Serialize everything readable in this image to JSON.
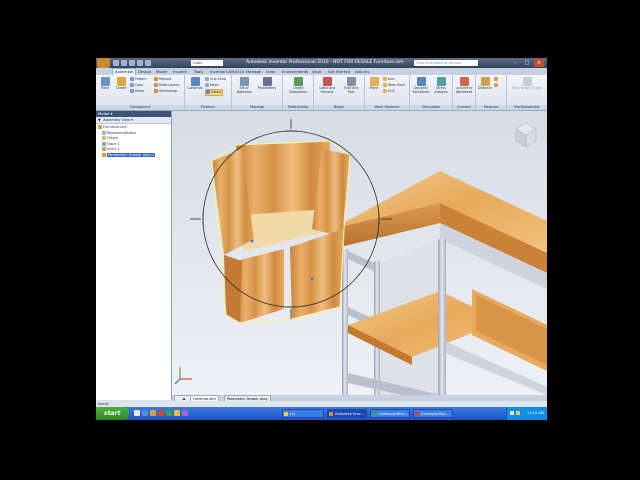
{
  "window": {
    "title": "Autodesk Inventor Professional 2010 - NOT FOR RESALE    Furniture.iam",
    "search_placeholder": "Type a keyword or phrase",
    "quick_access_value": "Color"
  },
  "tabs": [
    "Assemble",
    "Design",
    "Model",
    "Inspect",
    "Tools",
    "InventorCAM2010",
    "Manage",
    "View",
    "Environments",
    "Vault",
    "Get Started",
    "Add-Ins"
  ],
  "ribbon": {
    "groups": [
      {
        "name": "Component"
      },
      {
        "name": "Position"
      },
      {
        "name": "Manage"
      },
      {
        "name": "Productivity"
      },
      {
        "name": "Begin"
      },
      {
        "name": "Work Features"
      },
      {
        "name": "Simulation"
      },
      {
        "name": "Convert"
      },
      {
        "name": "Measure"
      },
      {
        "name": "iPartiAssembly"
      }
    ],
    "place_label": "Place",
    "create_label": "Create",
    "pattern_label": "Pattern",
    "copy_label": "Copy",
    "mirror_label": "Mirror",
    "replace_label": "Replace",
    "make_layout_label": "Make Layout",
    "shrinkwrap_label": "Shrinkwrap",
    "constrain_label": "Constrain",
    "grip_snap_label": "Grip Snap",
    "move_label": "Move",
    "rotate_label": "Rotate",
    "bom_label": "Bill of Materials",
    "parameters_label": "Parameters",
    "create_substitutes_label": "Create Substitutes",
    "cable_harness_label": "Cable and Harness",
    "tube_pipe_label": "Tube and Pipe",
    "plane_label": "Plane",
    "axis_label": "Axis",
    "work_point_label": "Work Point",
    "ucs_label": "UCS",
    "dynamic_sim_label": "Dynamic Simulation",
    "stress_label": "Stress Analysis",
    "convert_label": "Convert to Weldment",
    "distance_label": "Distance",
    "edit_factory_label": "Edit Factory Scope"
  },
  "browser": {
    "header": "Model",
    "view_label": "Assembly View",
    "items": [
      {
        "label": "Furniture.iam",
        "indent": 0
      },
      {
        "label": "Representations",
        "indent": 1
      },
      {
        "label": "Origin",
        "indent": 1
      },
      {
        "label": "Floor:1",
        "indent": 1
      },
      {
        "label": "unit1:1",
        "indent": 1
      },
      {
        "label": "Parametric Drawer Assy:1",
        "indent": 1,
        "selected": true
      }
    ]
  },
  "doc_tabs": [
    "Furniture.iam",
    "Parametric Drawer Assy"
  ],
  "status": "Ready",
  "taskbar": {
    "start_label": "start",
    "buttons": [
      {
        "label": "H:\\"
      },
      {
        "label": "Autodesk Inve..."
      },
      {
        "label": "Camtasia Reco..."
      },
      {
        "label": "Camtasia Rec..."
      }
    ],
    "clock": "11:15 AM"
  },
  "colors": {
    "wood": "#e7a95a",
    "wood_dark": "#c9803a",
    "steel": "#d8dbe4",
    "selection": "#f4f4a0"
  }
}
